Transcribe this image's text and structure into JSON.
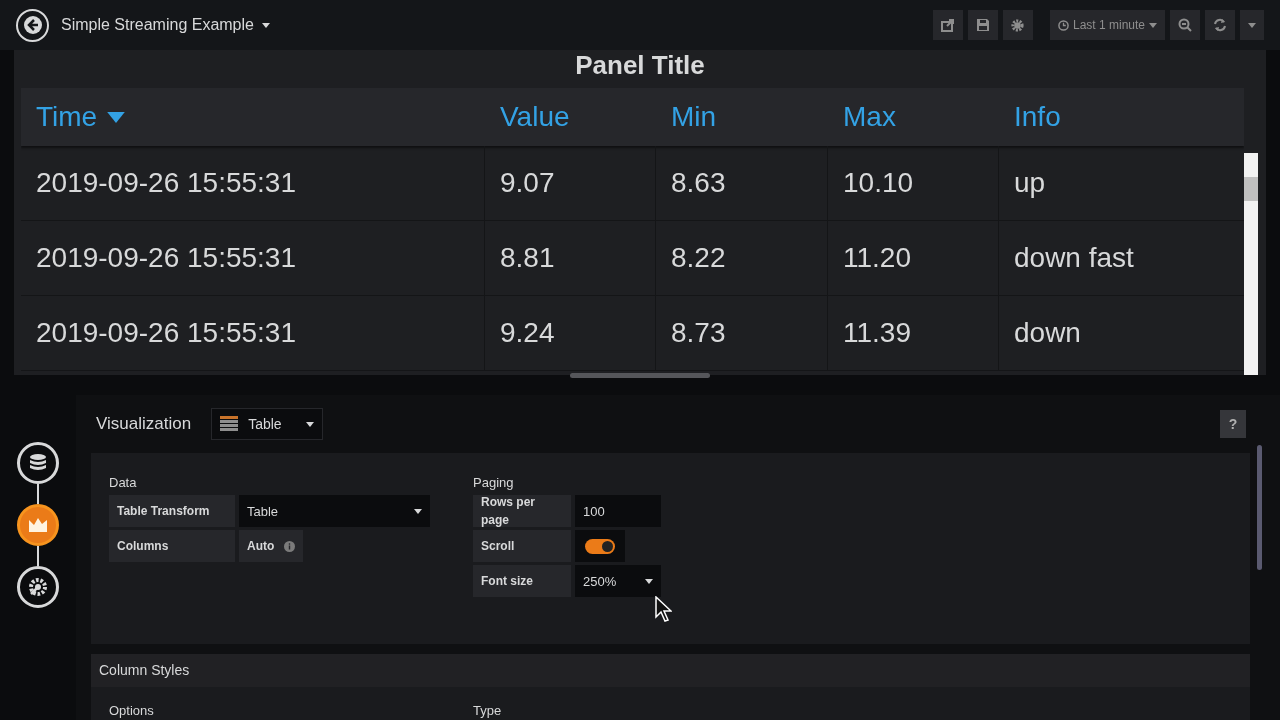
{
  "header": {
    "title": "Simple Streaming Example",
    "time_range": "Last 1 minute"
  },
  "panel": {
    "title": "Panel Title",
    "columns": [
      {
        "label": "Time",
        "sorted": true
      },
      {
        "label": "Value",
        "sorted": false
      },
      {
        "label": "Min",
        "sorted": false
      },
      {
        "label": "Max",
        "sorted": false
      },
      {
        "label": "Info",
        "sorted": false
      }
    ],
    "rows": [
      [
        "2019-09-26 15:55:31",
        "9.07",
        "8.63",
        "10.10",
        "up"
      ],
      [
        "2019-09-26 15:55:31",
        "8.81",
        "8.22",
        "11.20",
        "down fast"
      ],
      [
        "2019-09-26 15:55:31",
        "9.24",
        "8.73",
        "11.39",
        "down"
      ]
    ]
  },
  "editor": {
    "steps": [
      {
        "kind": "queries",
        "selected": false
      },
      {
        "kind": "visualization",
        "selected": true
      },
      {
        "kind": "general",
        "selected": false
      }
    ],
    "title": "Visualization",
    "viz_type": "Table",
    "help": "?",
    "data": {
      "heading": "Data",
      "table_transform": {
        "label": "Table Transform",
        "value": "Table"
      },
      "columns": {
        "label": "Columns",
        "value": "Auto"
      }
    },
    "paging": {
      "heading": "Paging",
      "rows_per_page": {
        "label": "Rows per page",
        "value": "100"
      },
      "scroll": {
        "label": "Scroll",
        "on": true
      },
      "font_size": {
        "label": "Font size",
        "value": "250%"
      }
    },
    "column_styles": {
      "title": "Column Styles",
      "fields": [
        "Options",
        "Type"
      ]
    }
  }
}
